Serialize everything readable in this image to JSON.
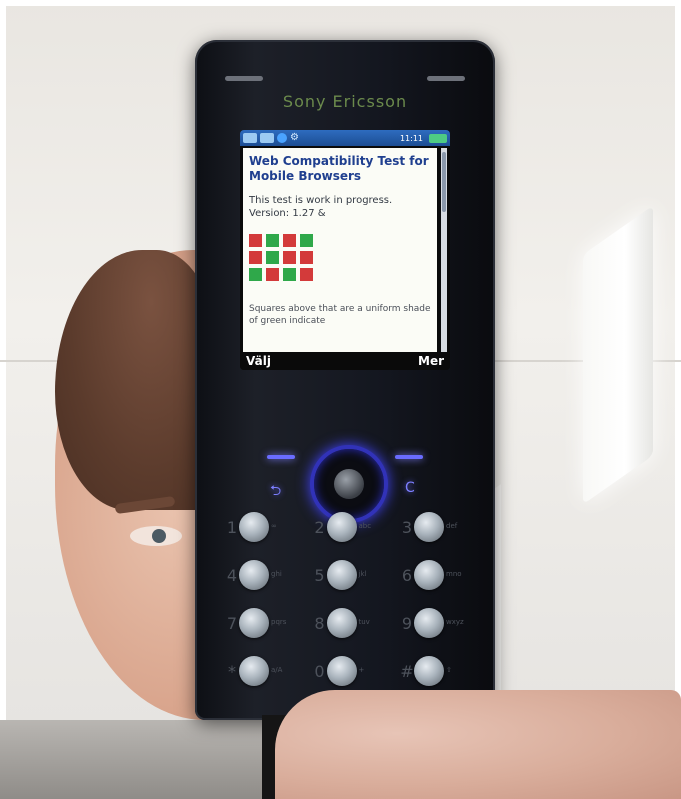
{
  "phone": {
    "brand": "Sony Ericsson",
    "status_bar": {
      "time": "11:11",
      "icons": [
        "window-icon",
        "window-icon",
        "globe-icon",
        "gear-icon",
        "battery-icon"
      ]
    },
    "browser_page": {
      "title": "Web Compatibility Test for Mobile Browsers",
      "text": "This test is work in progress. Version: 1.27 &",
      "grid_colors": [
        "#d33a3a",
        "#2fa84a",
        "#d33a3a",
        "#2fa84a",
        "#d33a3a",
        "#2fa84a",
        "#d33a3a",
        "#d33a3a",
        "#2fa84a",
        "#d33a3a",
        "#2fa84a",
        "#d33a3a"
      ],
      "footer": "Squares above that are a uniform shade of green indicate"
    },
    "softkeys": {
      "left": "Välj",
      "right": "Mer"
    },
    "keypad": [
      [
        {
          "num": "1",
          "sub": "∞"
        },
        {
          "num": "2",
          "sub": "abc"
        },
        {
          "num": "3",
          "sub": "def"
        }
      ],
      [
        {
          "num": "4",
          "sub": "ghi"
        },
        {
          "num": "5",
          "sub": "jkl"
        },
        {
          "num": "6",
          "sub": "mno"
        }
      ],
      [
        {
          "num": "7",
          "sub": "pqrs"
        },
        {
          "num": "8",
          "sub": "tuv"
        },
        {
          "num": "9",
          "sub": "wxyz"
        }
      ],
      [
        {
          "num": "*",
          "sub": "a/A"
        },
        {
          "num": "0",
          "sub": "+"
        },
        {
          "num": "#",
          "sub": "⇧"
        }
      ]
    ]
  }
}
